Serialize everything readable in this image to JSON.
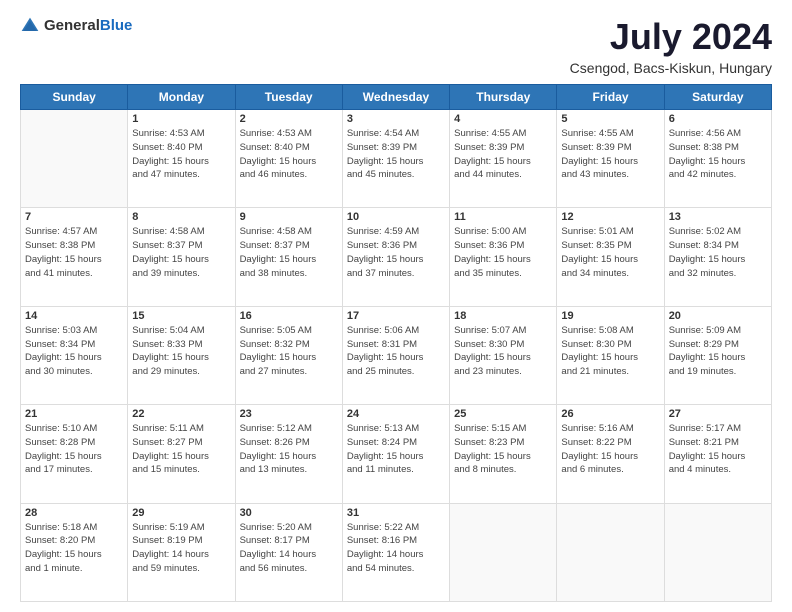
{
  "logo": {
    "general": "General",
    "blue": "Blue"
  },
  "title": "July 2024",
  "subtitle": "Csengod, Bacs-Kiskun, Hungary",
  "headers": [
    "Sunday",
    "Monday",
    "Tuesday",
    "Wednesday",
    "Thursday",
    "Friday",
    "Saturday"
  ],
  "weeks": [
    [
      {
        "day": "",
        "info": ""
      },
      {
        "day": "1",
        "info": "Sunrise: 4:53 AM\nSunset: 8:40 PM\nDaylight: 15 hours\nand 47 minutes."
      },
      {
        "day": "2",
        "info": "Sunrise: 4:53 AM\nSunset: 8:40 PM\nDaylight: 15 hours\nand 46 minutes."
      },
      {
        "day": "3",
        "info": "Sunrise: 4:54 AM\nSunset: 8:39 PM\nDaylight: 15 hours\nand 45 minutes."
      },
      {
        "day": "4",
        "info": "Sunrise: 4:55 AM\nSunset: 8:39 PM\nDaylight: 15 hours\nand 44 minutes."
      },
      {
        "day": "5",
        "info": "Sunrise: 4:55 AM\nSunset: 8:39 PM\nDaylight: 15 hours\nand 43 minutes."
      },
      {
        "day": "6",
        "info": "Sunrise: 4:56 AM\nSunset: 8:38 PM\nDaylight: 15 hours\nand 42 minutes."
      }
    ],
    [
      {
        "day": "7",
        "info": "Sunrise: 4:57 AM\nSunset: 8:38 PM\nDaylight: 15 hours\nand 41 minutes."
      },
      {
        "day": "8",
        "info": "Sunrise: 4:58 AM\nSunset: 8:37 PM\nDaylight: 15 hours\nand 39 minutes."
      },
      {
        "day": "9",
        "info": "Sunrise: 4:58 AM\nSunset: 8:37 PM\nDaylight: 15 hours\nand 38 minutes."
      },
      {
        "day": "10",
        "info": "Sunrise: 4:59 AM\nSunset: 8:36 PM\nDaylight: 15 hours\nand 37 minutes."
      },
      {
        "day": "11",
        "info": "Sunrise: 5:00 AM\nSunset: 8:36 PM\nDaylight: 15 hours\nand 35 minutes."
      },
      {
        "day": "12",
        "info": "Sunrise: 5:01 AM\nSunset: 8:35 PM\nDaylight: 15 hours\nand 34 minutes."
      },
      {
        "day": "13",
        "info": "Sunrise: 5:02 AM\nSunset: 8:34 PM\nDaylight: 15 hours\nand 32 minutes."
      }
    ],
    [
      {
        "day": "14",
        "info": "Sunrise: 5:03 AM\nSunset: 8:34 PM\nDaylight: 15 hours\nand 30 minutes."
      },
      {
        "day": "15",
        "info": "Sunrise: 5:04 AM\nSunset: 8:33 PM\nDaylight: 15 hours\nand 29 minutes."
      },
      {
        "day": "16",
        "info": "Sunrise: 5:05 AM\nSunset: 8:32 PM\nDaylight: 15 hours\nand 27 minutes."
      },
      {
        "day": "17",
        "info": "Sunrise: 5:06 AM\nSunset: 8:31 PM\nDaylight: 15 hours\nand 25 minutes."
      },
      {
        "day": "18",
        "info": "Sunrise: 5:07 AM\nSunset: 8:30 PM\nDaylight: 15 hours\nand 23 minutes."
      },
      {
        "day": "19",
        "info": "Sunrise: 5:08 AM\nSunset: 8:30 PM\nDaylight: 15 hours\nand 21 minutes."
      },
      {
        "day": "20",
        "info": "Sunrise: 5:09 AM\nSunset: 8:29 PM\nDaylight: 15 hours\nand 19 minutes."
      }
    ],
    [
      {
        "day": "21",
        "info": "Sunrise: 5:10 AM\nSunset: 8:28 PM\nDaylight: 15 hours\nand 17 minutes."
      },
      {
        "day": "22",
        "info": "Sunrise: 5:11 AM\nSunset: 8:27 PM\nDaylight: 15 hours\nand 15 minutes."
      },
      {
        "day": "23",
        "info": "Sunrise: 5:12 AM\nSunset: 8:26 PM\nDaylight: 15 hours\nand 13 minutes."
      },
      {
        "day": "24",
        "info": "Sunrise: 5:13 AM\nSunset: 8:24 PM\nDaylight: 15 hours\nand 11 minutes."
      },
      {
        "day": "25",
        "info": "Sunrise: 5:15 AM\nSunset: 8:23 PM\nDaylight: 15 hours\nand 8 minutes."
      },
      {
        "day": "26",
        "info": "Sunrise: 5:16 AM\nSunset: 8:22 PM\nDaylight: 15 hours\nand 6 minutes."
      },
      {
        "day": "27",
        "info": "Sunrise: 5:17 AM\nSunset: 8:21 PM\nDaylight: 15 hours\nand 4 minutes."
      }
    ],
    [
      {
        "day": "28",
        "info": "Sunrise: 5:18 AM\nSunset: 8:20 PM\nDaylight: 15 hours\nand 1 minute."
      },
      {
        "day": "29",
        "info": "Sunrise: 5:19 AM\nSunset: 8:19 PM\nDaylight: 14 hours\nand 59 minutes."
      },
      {
        "day": "30",
        "info": "Sunrise: 5:20 AM\nSunset: 8:17 PM\nDaylight: 14 hours\nand 56 minutes."
      },
      {
        "day": "31",
        "info": "Sunrise: 5:22 AM\nSunset: 8:16 PM\nDaylight: 14 hours\nand 54 minutes."
      },
      {
        "day": "",
        "info": ""
      },
      {
        "day": "",
        "info": ""
      },
      {
        "day": "",
        "info": ""
      }
    ]
  ]
}
